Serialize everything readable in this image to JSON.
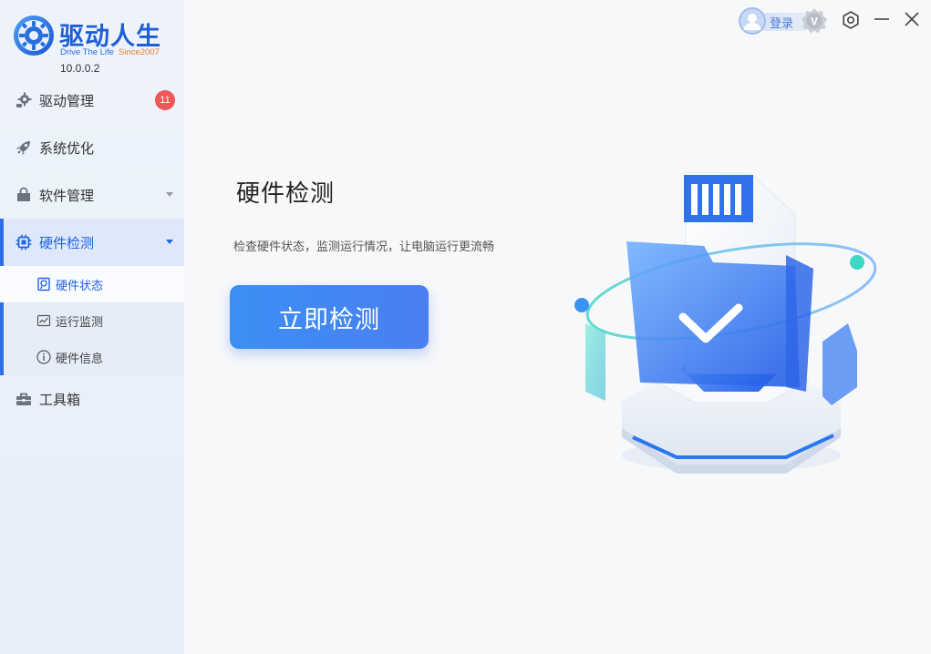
{
  "app": {
    "title": "驱动人生",
    "subtitle": "Drive The Life",
    "since": "Since2007",
    "version": "10.0.0.2"
  },
  "topbar": {
    "login_label": "登录",
    "vip_label": "V"
  },
  "sidebar": {
    "items": [
      {
        "label": "驱动管理",
        "icon": "gear-chip-icon",
        "badge": "11"
      },
      {
        "label": "系统优化",
        "icon": "rocket-icon"
      },
      {
        "label": "软件管理",
        "icon": "bag-icon"
      },
      {
        "label": "硬件检测",
        "icon": "chip-icon"
      },
      {
        "label": "工具箱",
        "icon": "toolbox-icon"
      }
    ],
    "subitems": [
      {
        "label": "硬件状态",
        "icon": "hardware-status-icon"
      },
      {
        "label": "运行监测",
        "icon": "monitor-chart-icon"
      },
      {
        "label": "硬件信息",
        "icon": "info-icon"
      }
    ]
  },
  "main": {
    "title": "硬件检测",
    "description": "检查硬件状态，监测运行情况，让电脑运行更流畅",
    "button_label": "立即检测"
  },
  "colors": {
    "accent": "#1e63e0",
    "brand": "#1f5fd6",
    "badge": "#ef5757",
    "button": "#3b8ff3"
  }
}
